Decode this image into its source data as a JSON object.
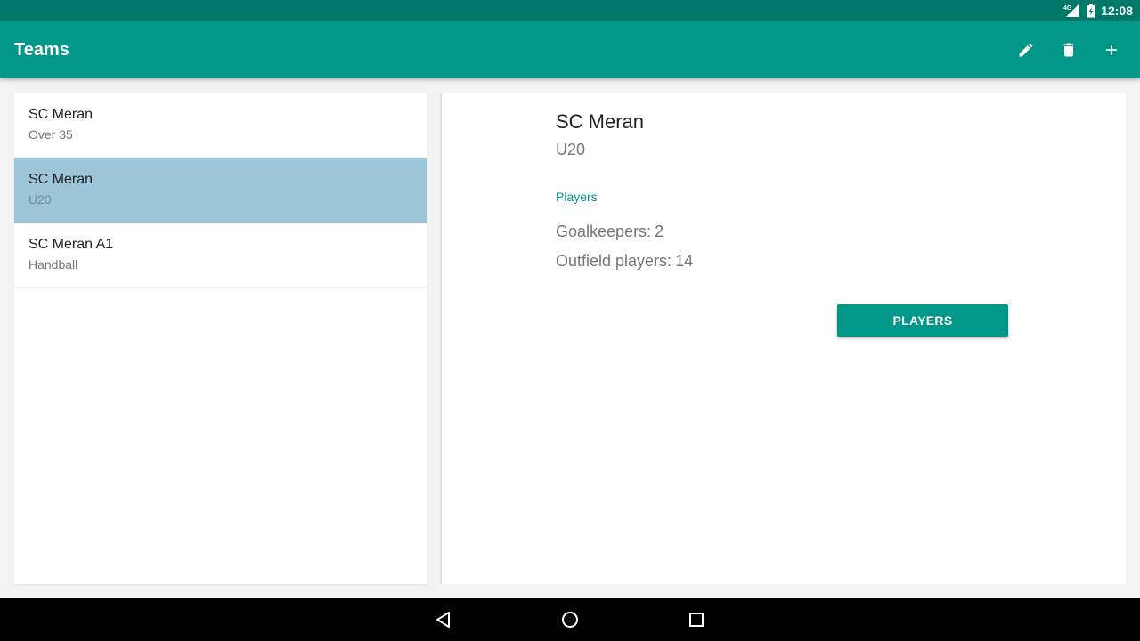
{
  "status_bar": {
    "network_label": "4G",
    "time": "12:08",
    "icons": [
      "signal-icon",
      "battery-charging-icon"
    ]
  },
  "app_bar": {
    "title": "Teams",
    "actions": [
      "edit-icon",
      "delete-icon",
      "add-icon"
    ]
  },
  "teams_list": [
    {
      "name": "SC Meran",
      "category": "Over 35",
      "selected": false
    },
    {
      "name": "SC Meran",
      "category": "U20",
      "selected": true
    },
    {
      "name": "SC Meran A1",
      "category": "Handball",
      "selected": false
    }
  ],
  "detail": {
    "team_name": "SC Meran",
    "category": "U20",
    "section_header": "Players",
    "goalkeepers_label": "Goalkeepers:",
    "goalkeepers_value": "2",
    "outfield_label": "Outfield players:",
    "outfield_value": "14",
    "players_button_label": "PLAYERS"
  },
  "colors": {
    "primary": "#009688",
    "primary_dark": "#00796b",
    "selected_row": "#9cc5d8"
  },
  "nav_bar": {
    "buttons": [
      "back-icon",
      "home-icon",
      "recents-icon"
    ]
  }
}
